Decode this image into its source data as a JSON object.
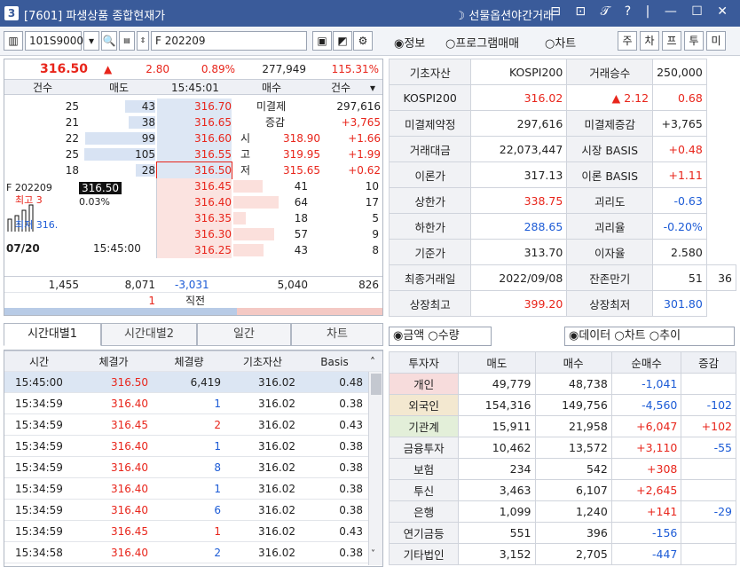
{
  "window": {
    "badge": "3",
    "title": "[7601] 파생상품 종합현재가",
    "right_label": "선물옵션야간거래",
    "buttons": "⊟ ⊡ 𝒯 ? | — ☐ ✕"
  },
  "toolbar": {
    "code": "101S9000",
    "name": "F 202209",
    "radios": [
      "정보",
      "프로그램매매",
      "차트"
    ],
    "tabs": [
      "주",
      "차",
      "프",
      "투",
      "미"
    ]
  },
  "quote": {
    "price": "316.50",
    "change": "2.80",
    "pct": "0.89%",
    "volume": "277,949",
    "vol_pct": "115.31%"
  },
  "ob_header": {
    "c1": "건수",
    "c2": "매도",
    "time": "15:45:01",
    "c4": "매수",
    "c5": "건수"
  },
  "asks": [
    {
      "cnt": "25",
      "qty": "43",
      "price": "316.70"
    },
    {
      "cnt": "21",
      "qty": "38",
      "price": "316.65"
    },
    {
      "cnt": "22",
      "qty": "99",
      "price": "316.60"
    },
    {
      "cnt": "25",
      "qty": "105",
      "price": "316.55"
    },
    {
      "cnt": "18",
      "qty": "28",
      "price": "316.50"
    }
  ],
  "bids": [
    {
      "price": "316.45",
      "qty": "41",
      "cnt": "10"
    },
    {
      "price": "316.40",
      "qty": "64",
      "cnt": "17"
    },
    {
      "price": "316.35",
      "qty": "18",
      "cnt": "5"
    },
    {
      "price": "316.30",
      "qty": "57",
      "cnt": "9"
    },
    {
      "price": "316.25",
      "qty": "43",
      "cnt": "8"
    }
  ],
  "oi": {
    "l1": "미결제",
    "v1": "297,616",
    "l2": "증감",
    "v2": "+3,765"
  },
  "ohl": [
    {
      "l": "시",
      "v": "318.90",
      "d": "+1.66"
    },
    {
      "l": "고",
      "v": "319.95",
      "d": "+1.99"
    },
    {
      "l": "저",
      "v": "315.65",
      "d": "+0.62"
    }
  ],
  "mini": {
    "name": "F 202209",
    "price": "316.50",
    "pct": "0.03%",
    "hi": "최고 3",
    "lo": "최저 316.",
    "date": "07/20",
    "time": "15:45:00"
  },
  "totals": {
    "a": "1,455",
    "b": "8,071",
    "c": "-3,031",
    "d": "5,040",
    "e": "826",
    "f": "1",
    "g": "직전"
  },
  "tabs": [
    "시간대별1",
    "시간대별2",
    "일간",
    "차트"
  ],
  "ticks_header": [
    "시간",
    "체결가",
    "체결량",
    "기초자산",
    "Basis"
  ],
  "ticks": [
    {
      "t": "15:45:00",
      "p": "316.50",
      "q": "6,419",
      "u": "316.02",
      "b": "0.48",
      "qc": "blk"
    },
    {
      "t": "15:34:59",
      "p": "316.40",
      "q": "1",
      "u": "316.02",
      "b": "0.38",
      "qc": "blue"
    },
    {
      "t": "15:34:59",
      "p": "316.45",
      "q": "2",
      "u": "316.02",
      "b": "0.43",
      "qc": "red"
    },
    {
      "t": "15:34:59",
      "p": "316.40",
      "q": "1",
      "u": "316.02",
      "b": "0.38",
      "qc": "blue"
    },
    {
      "t": "15:34:59",
      "p": "316.40",
      "q": "8",
      "u": "316.02",
      "b": "0.38",
      "qc": "blue"
    },
    {
      "t": "15:34:59",
      "p": "316.40",
      "q": "1",
      "u": "316.02",
      "b": "0.38",
      "qc": "blue"
    },
    {
      "t": "15:34:59",
      "p": "316.40",
      "q": "6",
      "u": "316.02",
      "b": "0.38",
      "qc": "blue"
    },
    {
      "t": "15:34:59",
      "p": "316.45",
      "q": "1",
      "u": "316.02",
      "b": "0.43",
      "qc": "red"
    },
    {
      "t": "15:34:58",
      "p": "316.40",
      "q": "2",
      "u": "316.02",
      "b": "0.38",
      "qc": "blue"
    }
  ],
  "info": [
    [
      "기초자산",
      "KOSPI200",
      "거래승수",
      "250,000"
    ],
    [
      "KOSPI200",
      "316.02",
      "▲ 2.12",
      "0.68"
    ],
    [
      "미결제약정",
      "297,616",
      "미결제증감",
      "+3,765"
    ],
    [
      "거래대금",
      "22,073,447",
      "시장 BASIS",
      "+0.48"
    ],
    [
      "이론가",
      "317.13",
      "이론 BASIS",
      "+1.11"
    ],
    [
      "상한가",
      "338.75",
      "괴리도",
      "-0.63"
    ],
    [
      "하한가",
      "288.65",
      "괴리율",
      "-0.20%"
    ],
    [
      "기준가",
      "313.70",
      "이자율",
      "2.580"
    ],
    [
      "최종거래일",
      "2022/09/08",
      "잔존만기",
      "51",
      "36"
    ],
    [
      "상장최고",
      "399.20",
      "상장최저",
      "301.80"
    ]
  ],
  "inv_radios": {
    "left": [
      "금액",
      "수량"
    ],
    "right": [
      "데이터",
      "차트",
      "추이"
    ]
  },
  "inv_header": [
    "투자자",
    "매도",
    "매수",
    "순매수",
    "증감"
  ],
  "investors": [
    {
      "n": "개인",
      "s": "49,779",
      "b": "48,738",
      "net": "-1,041",
      "chg": "",
      "bg": "#f7dcdc"
    },
    {
      "n": "외국인",
      "s": "154,316",
      "b": "149,756",
      "net": "-4,560",
      "chg": "-102",
      "bg": "#f3e8d0"
    },
    {
      "n": "기관계",
      "s": "15,911",
      "b": "21,958",
      "net": "+6,047",
      "chg": "+102",
      "bg": "#e3efd9"
    },
    {
      "n": "금융투자",
      "s": "10,462",
      "b": "13,572",
      "net": "+3,110",
      "chg": "-55",
      "bg": ""
    },
    {
      "n": "보험",
      "s": "234",
      "b": "542",
      "net": "+308",
      "chg": "",
      "bg": ""
    },
    {
      "n": "투신",
      "s": "3,463",
      "b": "6,107",
      "net": "+2,645",
      "chg": "",
      "bg": ""
    },
    {
      "n": "은행",
      "s": "1,099",
      "b": "1,240",
      "net": "+141",
      "chg": "-29",
      "bg": ""
    },
    {
      "n": "연기금등",
      "s": "551",
      "b": "396",
      "net": "-156",
      "chg": "",
      "bg": ""
    },
    {
      "n": "기타법인",
      "s": "3,152",
      "b": "2,705",
      "net": "-447",
      "chg": "",
      "bg": ""
    }
  ]
}
